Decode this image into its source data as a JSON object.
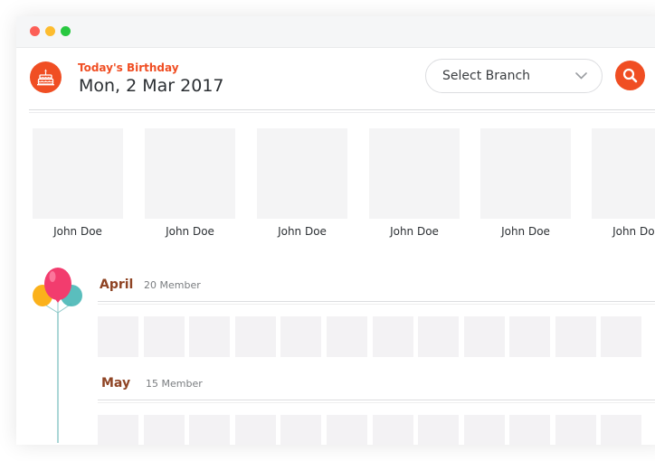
{
  "header": {
    "label": "Today's  Birthday",
    "date": "Mon, 2 Mar 2017",
    "branch_select": "Select Branch"
  },
  "icons": {
    "cake": "cake-icon",
    "search": "search-icon",
    "chevron": "chevron-down-icon",
    "balloons": "balloons-icon"
  },
  "colors": {
    "accent": "#f04e23",
    "month_title": "#8f4424",
    "placeholder": "#f4f4f5"
  },
  "today_birthdays": [
    {
      "name": "John Doe"
    },
    {
      "name": "John Doe"
    },
    {
      "name": "John Doe"
    },
    {
      "name": "John Doe"
    },
    {
      "name": "John Doe"
    },
    {
      "name": "John Doe"
    }
  ],
  "months": [
    {
      "name": "April",
      "count": "20 Member"
    },
    {
      "name": "May",
      "count": "15 Member"
    }
  ]
}
